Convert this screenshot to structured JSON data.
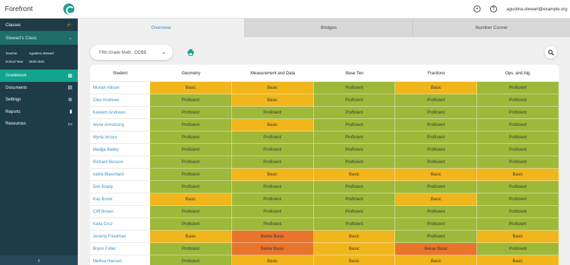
{
  "app": {
    "name": "Forefront",
    "logo_icon": "forefront-logo-icon"
  },
  "sidebar": {
    "classes_label": "Classes",
    "class_name": "Stewart's Class",
    "teacher_label": "Teacher",
    "teacher_name": "Agustina Stewart",
    "year_label": "School Year",
    "year_value": "2020-2021",
    "nav": [
      {
        "label": "Gradebook",
        "icon": "gradebook-icon"
      },
      {
        "label": "Documents",
        "icon": "documents-icon"
      },
      {
        "label": "Settings",
        "icon": "settings-icon"
      },
      {
        "label": "Reports",
        "icon": "reports-icon"
      },
      {
        "label": "Resources",
        "icon": "resources-icon"
      }
    ]
  },
  "topbar": {
    "email": "agustina.stewart@example.org"
  },
  "tabs": [
    {
      "label": "Overview"
    },
    {
      "label": "Bridges"
    },
    {
      "label": "Number Corner"
    }
  ],
  "filter": {
    "label": "Fifth Grade Math:",
    "value": "CCSS"
  },
  "table": {
    "headers": [
      "Student",
      "Geometry",
      "Measurement and Data",
      "Base Ten",
      "Fractions",
      "Ops. and Alg."
    ],
    "rows": [
      {
        "name": "Moriah Allison",
        "scores": [
          "Basic",
          "Basic",
          "Proficient",
          "Basic",
          "Proficient"
        ]
      },
      {
        "name": "Cleo Andrews",
        "scores": [
          "Proficient",
          "Basic",
          "Proficient",
          "Proficient",
          "Proficient"
        ]
      },
      {
        "name": "Kareem Andrews",
        "scores": [
          "Proficient",
          "Proficient",
          "Proficient",
          "Proficient",
          "Proficient"
        ]
      },
      {
        "name": "Alyse Armstrong",
        "scores": [
          "Proficient",
          "Basic",
          "Proficient",
          "Proficient",
          "Proficient"
        ]
      },
      {
        "name": "Myrta Arroyo",
        "scores": [
          "Proficient",
          "Proficient",
          "Proficient",
          "Proficient",
          "Proficient"
        ]
      },
      {
        "name": "Madge Bailey",
        "scores": [
          "Proficient",
          "Proficient",
          "Proficient",
          "Proficient",
          "Proficient"
        ]
      },
      {
        "name": "Richard Benson",
        "scores": [
          "Proficient",
          "Proficient",
          "Proficient",
          "Proficient",
          "Proficient"
        ]
      },
      {
        "name": "Isidra Blanchard",
        "scores": [
          "Proficient",
          "Basic",
          "Basic",
          "Basic",
          "Basic"
        ]
      },
      {
        "name": "Dirk Brady",
        "scores": [
          "Proficient",
          "Proficient",
          "Proficient",
          "Proficient",
          "Proficient"
        ]
      },
      {
        "name": "Kay Brock",
        "scores": [
          "Basic",
          "Proficient",
          "Proficient",
          "Basic",
          "Proficient"
        ]
      },
      {
        "name": "Cliff Brown",
        "scores": [
          "Proficient",
          "Proficient",
          "Proficient",
          "Proficient",
          "Proficient"
        ]
      },
      {
        "name": "Kaila Cruz",
        "scores": [
          "Proficient",
          "Proficient",
          "Proficient",
          "Proficient",
          "Proficient"
        ]
      },
      {
        "name": "Jeremy Friedman",
        "scores": [
          "Basic",
          "Below Basic",
          "Basic",
          "Proficient",
          "Basic"
        ]
      },
      {
        "name": "Brynn Fuller",
        "scores": [
          "Proficient",
          "Below Basic",
          "Basic",
          "Below Basic",
          "Proficient"
        ]
      },
      {
        "name": "Mellisa Hansen",
        "scores": [
          "Proficient",
          "Basic",
          "Basic",
          "Basic",
          "Basic"
        ]
      }
    ]
  },
  "colors": {
    "sidebar_bg": "#1e3b48",
    "active_nav": "#12a48f",
    "proficient": "#9eb83a",
    "basic": "#f0b61c",
    "below_basic": "#e9742b",
    "link": "#3d8fbf"
  }
}
